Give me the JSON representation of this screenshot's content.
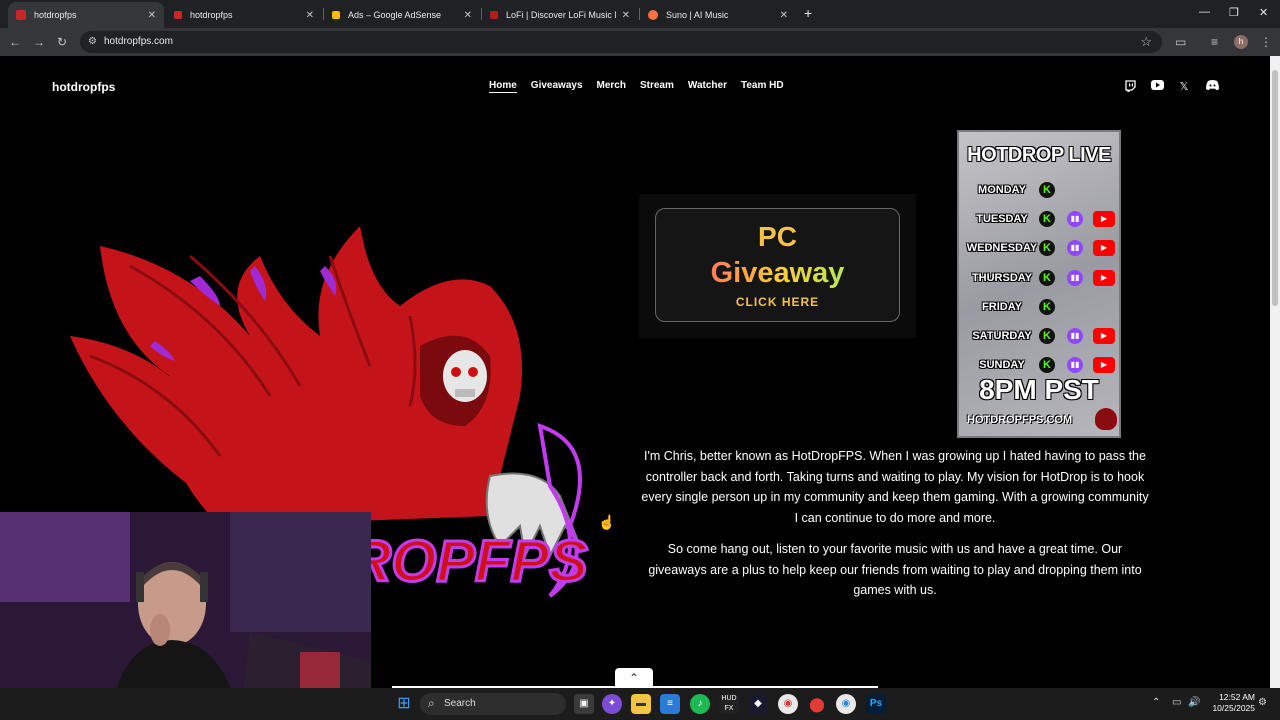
{
  "browser": {
    "tabs": [
      {
        "title": "hotdropfps",
        "active": true,
        "favicon_color": "#c62828"
      },
      {
        "title": "hotdropfps",
        "active": false,
        "favicon_color": "#c62828"
      },
      {
        "title": "Ads – Google AdSense",
        "active": false,
        "favicon_color": "#fbbc04"
      },
      {
        "title": "LoFi | Discover LoFi Music Now",
        "active": false,
        "favicon_color": "#b71c1c"
      },
      {
        "title": "Suno | AI Music",
        "active": false,
        "favicon_color": "#ff7043"
      }
    ],
    "url": "hotdropfps.com",
    "profile_initial": "h"
  },
  "site": {
    "brand": "hotdropfps",
    "nav": [
      "Home",
      "Giveaways",
      "Merch",
      "Stream",
      "Watcher",
      "Team HD"
    ],
    "active_nav": "Home",
    "social_icons": [
      "twitch-icon",
      "youtube-icon",
      "x-icon",
      "discord-icon"
    ],
    "logo_text": "HOTDROPFPS",
    "giveaway": {
      "line1": "PC",
      "line2": "Giveaway",
      "line3": "CLICK HERE"
    },
    "schedule": {
      "title": "HOTDROP LIVE",
      "days": [
        {
          "day": "MONDAY",
          "kick": true,
          "twitch": false,
          "youtube": false
        },
        {
          "day": "TUESDAY",
          "kick": true,
          "twitch": true,
          "youtube": true
        },
        {
          "day": "WEDNESDAY",
          "kick": true,
          "twitch": true,
          "youtube": true
        },
        {
          "day": "THURSDAY",
          "kick": true,
          "twitch": true,
          "youtube": true
        },
        {
          "day": "FRIDAY",
          "kick": true,
          "twitch": false,
          "youtube": false
        },
        {
          "day": "SATURDAY",
          "kick": true,
          "twitch": true,
          "youtube": true
        },
        {
          "day": "SUNDAY",
          "kick": true,
          "twitch": true,
          "youtube": true
        }
      ],
      "time": "8PM PST",
      "site": "HOTDROPFPS.COM"
    },
    "paragraph1": "I'm Chris, better known as HotDropFPS. When I was growing up I hated having to pass the controller back and forth. Taking turns and waiting to play. My vision for HotDrop is to hook every single person up in my community and keep them gaming. With a growing community I can continue to do more and more.",
    "paragraph2": "So come hang out, listen to your favorite music with us and have a great time. Our giveaways are a plus to help keep our friends from waiting to play and dropping them into games with us."
  },
  "taskbar": {
    "search_label": "Search",
    "time": "12:52 AM",
    "date": "10/25/2025"
  }
}
